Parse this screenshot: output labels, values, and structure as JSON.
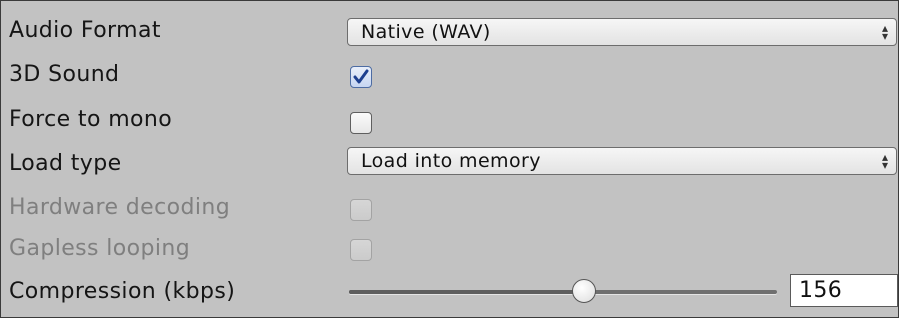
{
  "fields": {
    "audio_format": {
      "label": "Audio Format",
      "value": "Native (WAV)"
    },
    "sound_3d": {
      "label": "3D Sound",
      "checked": true
    },
    "force_mono": {
      "label": "Force to mono",
      "checked": false
    },
    "load_type": {
      "label": "Load type",
      "value": "Load into memory"
    },
    "hardware_decoding": {
      "label": "Hardware decoding",
      "checked": false,
      "disabled": true
    },
    "gapless_looping": {
      "label": "Gapless looping",
      "checked": false,
      "disabled": true
    },
    "compression": {
      "label": "Compression (kbps)",
      "value": "156",
      "slider_fraction": 0.55
    }
  },
  "dropdown_arrow": "↕"
}
